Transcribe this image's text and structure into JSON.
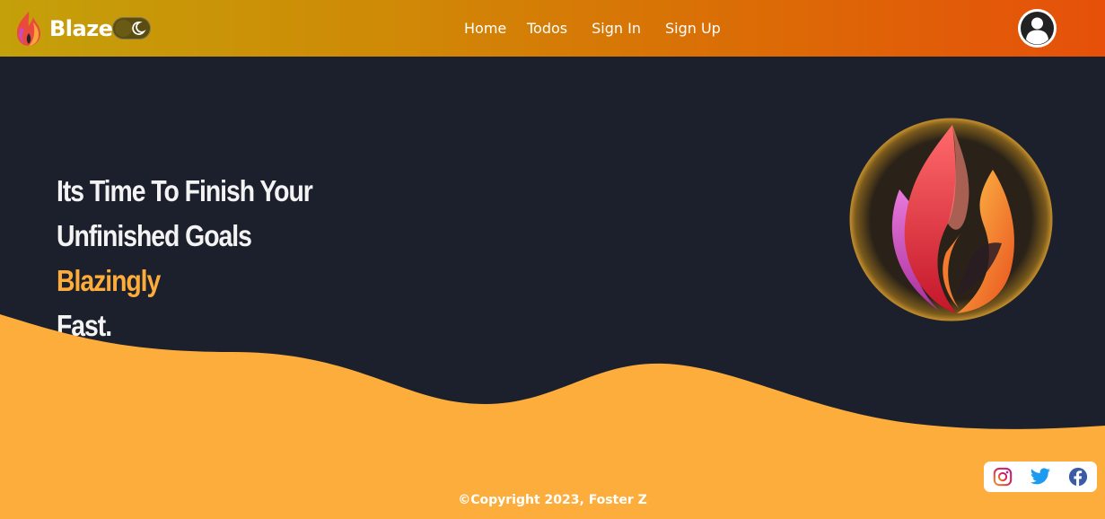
{
  "brand": {
    "name": "Blaze",
    "logo_icon": "flame-icon"
  },
  "theme_toggle": {
    "icon": "moon-icon",
    "state": "dark"
  },
  "nav": {
    "links": [
      {
        "label": "Home"
      },
      {
        "label": "Todos"
      },
      {
        "label": "Sign In"
      },
      {
        "label": "Sign Up"
      }
    ]
  },
  "user": {
    "icon": "user-avatar-icon"
  },
  "hero": {
    "line1": "Its Time To Finish Your",
    "line2_prefix": "Unfinished Goals ",
    "line2_accent": "Blazingly",
    "line3": "Fast.",
    "emblem_icon": "flame-emblem-icon"
  },
  "social": {
    "instagram_icon": "instagram-icon",
    "twitter_icon": "twitter-icon",
    "facebook_icon": "facebook-icon"
  },
  "footer": {
    "copyright": "©Copyright 2023, Foster Z"
  },
  "colors": {
    "nav_gradient_start": "#c4a00a",
    "nav_gradient_end": "#e6500a",
    "hero_bg": "#1b202c",
    "accent": "#fdac3a",
    "wave": "#fcad3b"
  }
}
